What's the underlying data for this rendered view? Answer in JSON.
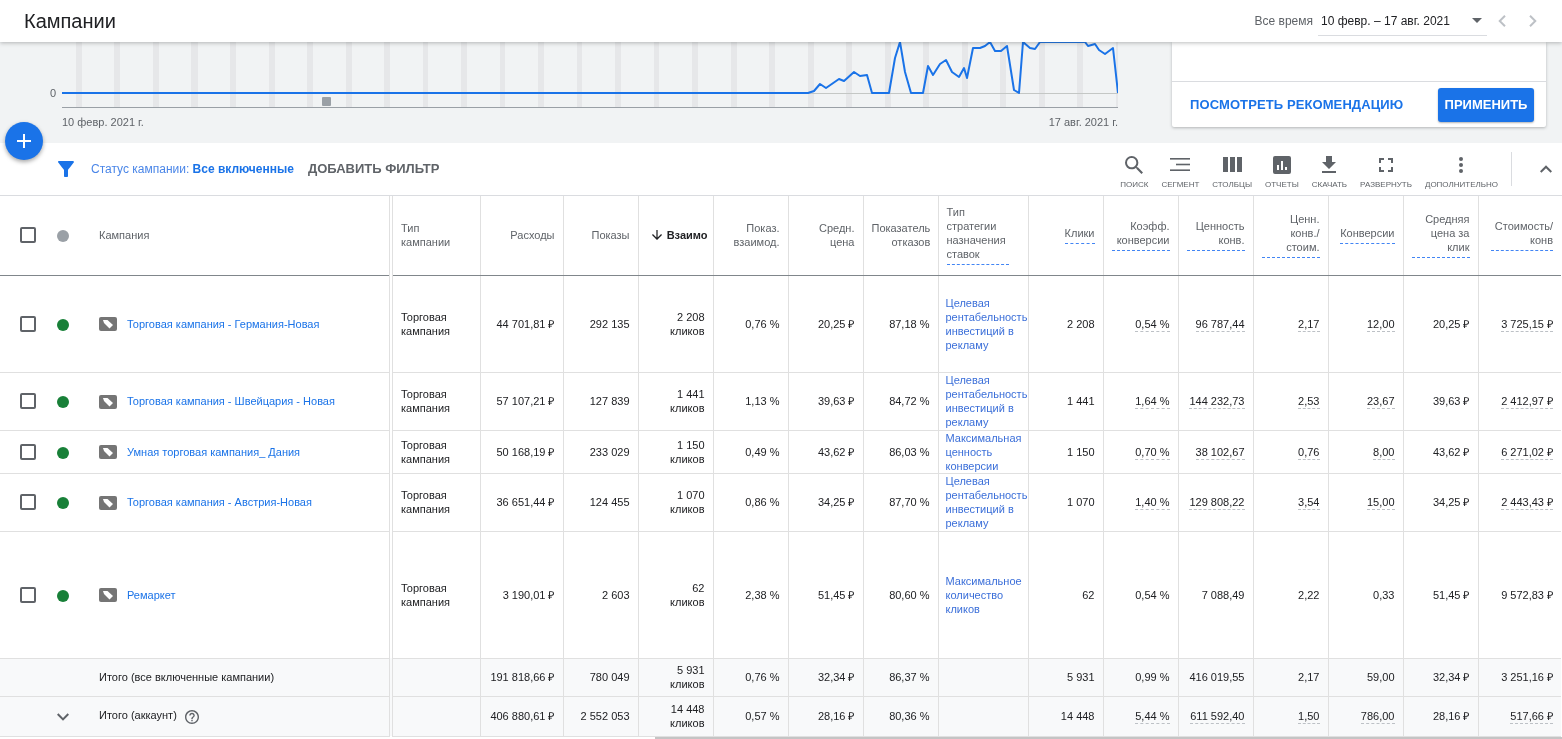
{
  "header": {
    "title": "Кампании",
    "range_label": "Все время",
    "date_range": "10 февр. – 17 авг. 2021"
  },
  "chart": {
    "y_label": "0",
    "x_start": "10 февр. 2021 г.",
    "x_end": "17 авг. 2021 г."
  },
  "recommendation": {
    "link": "ПОСМОТРЕТЬ РЕКОМЕНДАЦИЮ",
    "button": "ПРИМЕНИТЬ"
  },
  "filter": {
    "status": "Статус кампании: **Все включенные**",
    "add": "ДОБАВИТЬ ФИЛЬТР"
  },
  "toolbar": [
    {
      "kind": "search",
      "label": "ПОИСК"
    },
    {
      "kind": "segment",
      "label": "СЕГМЕНТ"
    },
    {
      "kind": "columns",
      "label": "СТОЛБЦЫ"
    },
    {
      "kind": "reports",
      "label": "ОТЧЕТЫ"
    },
    {
      "kind": "download",
      "label": "СКАЧАТЬ"
    },
    {
      "kind": "expand",
      "label": "РАЗВЕРНУТЬ"
    },
    {
      "kind": "more",
      "label": "ДОПОЛНИТЕЛЬНО"
    }
  ],
  "table": {
    "select_all": {
      "checked": false
    },
    "name_column": "Кампания",
    "columns": [
      {
        "label": "Тип кампании",
        "kind": "text",
        "dashed": false,
        "sorted": false,
        "hint": false
      },
      {
        "label": "Расходы",
        "kind": "number",
        "dashed": false,
        "sorted": false,
        "hint": false
      },
      {
        "label": "Показы",
        "kind": "number",
        "dashed": false,
        "sorted": false,
        "hint": false
      },
      {
        "label": "Взаимо",
        "kind": "count",
        "dashed": false,
        "sorted": true,
        "hint": false
      },
      {
        "label": "Показ. взаимод.",
        "kind": "number",
        "dashed": false,
        "sorted": false,
        "hint": false
      },
      {
        "label": "Средн. цена",
        "kind": "number",
        "dashed": false,
        "sorted": false,
        "hint": false
      },
      {
        "label": "Показатель отказов",
        "kind": "number",
        "dashed": false,
        "sorted": false,
        "hint": false
      },
      {
        "label": "Тип стратегии назначения ставок",
        "kind": "link",
        "dashed": true,
        "sorted": false,
        "hint": false
      },
      {
        "label": "Клики",
        "kind": "number",
        "dashed": true,
        "sorted": false,
        "hint": false
      },
      {
        "label": "Коэфф. конверсии",
        "kind": "number",
        "dashed": true,
        "sorted": false,
        "hint": true
      },
      {
        "label": "Ценность конв.",
        "kind": "number",
        "dashed": true,
        "sorted": false,
        "hint": true
      },
      {
        "label": "Ценн. конв./ стоим.",
        "kind": "number",
        "dashed": true,
        "sorted": false,
        "hint": true
      },
      {
        "label": "Конверсии",
        "kind": "number",
        "dashed": true,
        "sorted": false,
        "hint": true
      },
      {
        "label": "Средняя цена за клик",
        "kind": "number",
        "dashed": true,
        "sorted": false,
        "hint": false
      },
      {
        "label": "Стоимость/ конв",
        "kind": "number",
        "dashed": true,
        "sorted": false,
        "hint": true
      }
    ],
    "rows": [
      {
        "kind": "campaign",
        "checked": false,
        "enabled": true,
        "underlined": true,
        "name": "Торговая кампания - Германия-Новая",
        "cells": [
          "Торговая кампания",
          "44 701,81 ₽",
          "292 135",
          "2 208 кликов",
          "0,76 %",
          "20,25 ₽",
          "87,18 %",
          "Целевая рентабельность инвестиций в рекламу",
          "2 208",
          "0,54 %",
          "96 787,44",
          "2,17",
          "12,00",
          "20,25 ₽",
          "3 725,15 ₽"
        ]
      },
      {
        "kind": "campaign",
        "checked": false,
        "enabled": true,
        "underlined": true,
        "name": "Торговая кампания - Швейцария - Новая",
        "cells": [
          "Торговая кампания",
          "57 107,21 ₽",
          "127 839",
          "1 441 кликов",
          "1,13 %",
          "39,63 ₽",
          "84,72 %",
          "Целевая рентабельность инвестиций в рекламу",
          "1 441",
          "1,64 %",
          "144 232,73",
          "2,53",
          "23,67",
          "39,63 ₽",
          "2 412,97 ₽"
        ]
      },
      {
        "kind": "campaign",
        "checked": false,
        "enabled": true,
        "underlined": true,
        "name": "Умная торговая кампания_ Дания",
        "cells": [
          "Торговая кампания",
          "50 168,19 ₽",
          "233 029",
          "1 150 кликов",
          "0,49 %",
          "43,62 ₽",
          "86,03 %",
          "Максимальная ценность конверсии",
          "1 150",
          "0,70 %",
          "38 102,67",
          "0,76",
          "8,00",
          "43,62 ₽",
          "6 271,02 ₽"
        ]
      },
      {
        "kind": "campaign",
        "checked": false,
        "enabled": true,
        "underlined": true,
        "name": "Торговая кампания - Австрия-Новая",
        "cells": [
          "Торговая кампания",
          "36 651,44 ₽",
          "124 455",
          "1 070 кликов",
          "0,86 %",
          "34,25 ₽",
          "87,70 %",
          "Целевая рентабельность инвестиций в рекламу",
          "1 070",
          "1,40 %",
          "129 808,22",
          "3,54",
          "15,00",
          "34,25 ₽",
          "2 443,43 ₽"
        ]
      },
      {
        "kind": "campaign",
        "checked": false,
        "enabled": true,
        "underlined": false,
        "name": "Ремаркет",
        "cells": [
          "Торговая кампания",
          "3 190,01 ₽",
          "2 603",
          "62 кликов",
          "2,38 %",
          "51,45 ₽",
          "80,60 %",
          "Максимальное количество кликов",
          "62",
          "0,54 %",
          "7 088,49",
          "2,22",
          "0,33",
          "51,45 ₽",
          "9 572,83 ₽"
        ]
      },
      {
        "kind": "total",
        "underlined": false,
        "label": "Итого (все включенные кампании)",
        "cells": [
          null,
          "191 818,66 ₽",
          "780 049",
          "5 931 кликов",
          "0,76 %",
          "32,34 ₽",
          "86,37 %",
          null,
          "5 931",
          "0,99 %",
          "416 019,55",
          "2,17",
          "59,00",
          "32,34 ₽",
          "3 251,16 ₽"
        ]
      },
      {
        "kind": "account",
        "expanded": false,
        "underlined": true,
        "label": "Итого (аккаунт)",
        "cells": [
          null,
          "406 880,61 ₽",
          "2 552 053",
          "14 448 кликов",
          "0,57 %",
          "28,16 ₽",
          "80,36 %",
          null,
          "14 448",
          "5,44 %",
          "611 592,40",
          "1,50",
          "786,00",
          "28,16 ₽",
          "517,66 ₽"
        ]
      }
    ]
  }
}
